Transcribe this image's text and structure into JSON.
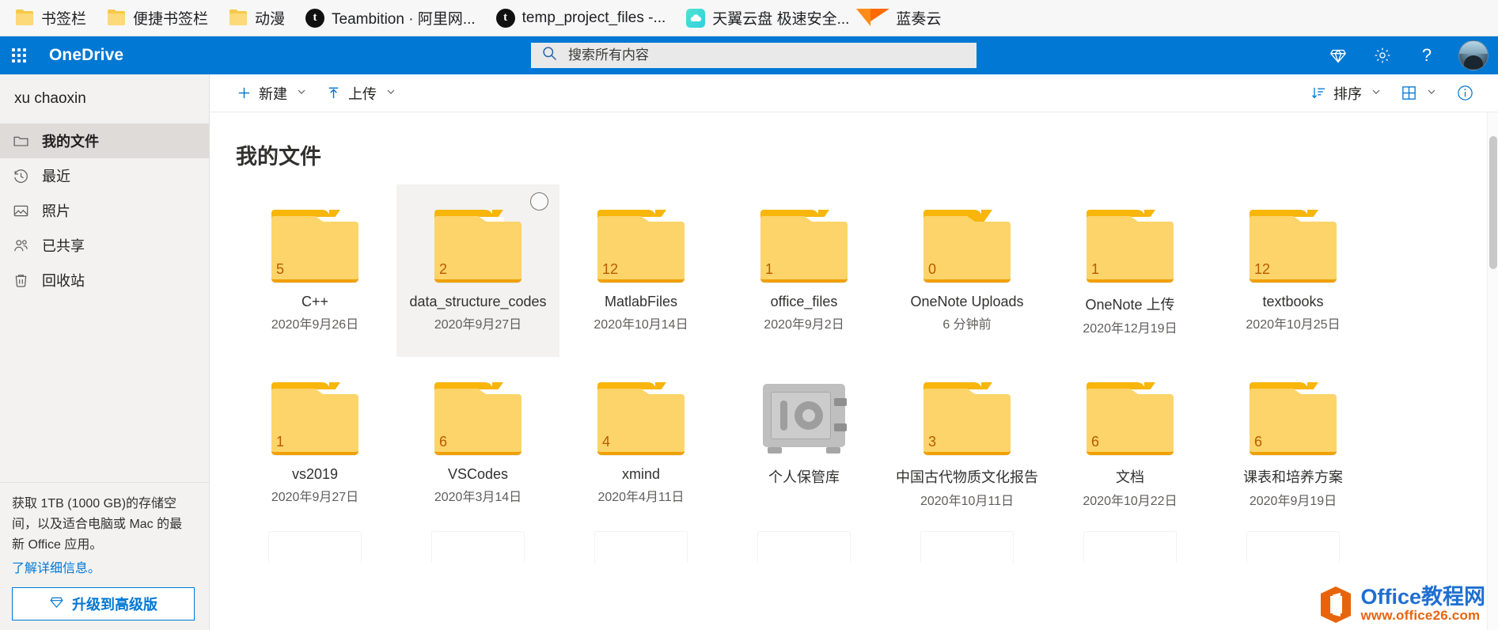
{
  "browser": {
    "bookmarks": [
      {
        "label": "书签栏",
        "icon": "folder-icon"
      },
      {
        "label": "便捷书签栏",
        "icon": "folder-icon"
      },
      {
        "label": "动漫",
        "icon": "folder-icon"
      },
      {
        "label": "Teambition · 阿里网...",
        "icon": "teambition-icon"
      },
      {
        "label": "temp_project_files -...",
        "icon": "teambition-icon"
      },
      {
        "label": "天翼云盘 极速安全...",
        "icon": "cloud-icon"
      },
      {
        "label": "蓝奏云",
        "icon": "lanzou-icon"
      }
    ]
  },
  "header": {
    "brand": "OneDrive",
    "waffle_label": "app-launcher",
    "search": {
      "placeholder": "搜索所有内容",
      "value": "",
      "icon": "search-icon"
    },
    "actions": [
      {
        "name": "premium-diamond-icon",
        "label": "高级版"
      },
      {
        "name": "gear-icon",
        "label": "设置"
      },
      {
        "name": "help-icon",
        "label": "帮助"
      }
    ],
    "avatar_label": "账户管理器",
    "accent_color": "#0078d4"
  },
  "sidebar": {
    "user": "xu chaoxin",
    "items": [
      {
        "label": "我的文件",
        "icon": "folder-icon",
        "selected": true
      },
      {
        "label": "最近",
        "icon": "clock-icon",
        "selected": false
      },
      {
        "label": "照片",
        "icon": "photo-icon",
        "selected": false
      },
      {
        "label": "已共享",
        "icon": "people-icon",
        "selected": false
      },
      {
        "label": "回收站",
        "icon": "recycle-bin-icon",
        "selected": false
      }
    ],
    "promo": {
      "text": "获取 1TB (1000 GB)的存储空间，以及适合电脑或 Mac 的最新 Office 应用。",
      "link": "了解详细信息。",
      "button": "升级到高级版",
      "button_icon": "diamond-icon"
    }
  },
  "commandbar": {
    "left": [
      {
        "label": "新建",
        "icon": "plus-icon",
        "has_chevron": true
      },
      {
        "label": "上传",
        "icon": "upload-arrow-icon",
        "has_chevron": true
      }
    ],
    "right": [
      {
        "label": "排序",
        "icon": "sort-icon",
        "has_chevron": true
      },
      {
        "label": "",
        "icon": "tiles-view-icon",
        "has_chevron": true
      },
      {
        "label": "",
        "icon": "info-icon",
        "has_chevron": false
      }
    ]
  },
  "main": {
    "title": "我的文件",
    "tiles": [
      {
        "name": "C++",
        "date": "2020年9月26日",
        "count": "5",
        "kind": "folder",
        "selected": false,
        "syncing": false
      },
      {
        "name": "data_structure_codes",
        "date": "2020年9月27日",
        "count": "2",
        "kind": "folder",
        "selected": true,
        "syncing": false
      },
      {
        "name": "MatlabFiles",
        "date": "2020年10月14日",
        "count": "12",
        "kind": "folder",
        "selected": false,
        "syncing": false
      },
      {
        "name": "office_files",
        "date": "2020年9月2日",
        "count": "1",
        "kind": "folder",
        "selected": false,
        "syncing": false
      },
      {
        "name": "OneNote Uploads",
        "date": "6 分钟前",
        "count": "0",
        "kind": "folder-empty",
        "selected": false,
        "syncing": true
      },
      {
        "name": "OneNote 上传",
        "date": "2020年12月19日",
        "count": "1",
        "kind": "folder",
        "selected": false,
        "syncing": false
      },
      {
        "name": "textbooks",
        "date": "2020年10月25日",
        "count": "12",
        "kind": "folder",
        "selected": false,
        "syncing": false
      },
      {
        "name": "vs2019",
        "date": "2020年9月27日",
        "count": "1",
        "kind": "folder",
        "selected": false,
        "syncing": false
      },
      {
        "name": "VSCodes",
        "date": "2020年3月14日",
        "count": "6",
        "kind": "folder",
        "selected": false,
        "syncing": false
      },
      {
        "name": "xmind",
        "date": "2020年4月11日",
        "count": "4",
        "kind": "folder-thumb-xmind",
        "selected": false,
        "syncing": false
      },
      {
        "name": "个人保管库",
        "date": "",
        "count": "",
        "kind": "vault",
        "selected": false,
        "syncing": false
      },
      {
        "name": "中国古代物质文化报告",
        "date": "2020年10月11日",
        "count": "3",
        "kind": "folder-thumb-note",
        "selected": false,
        "syncing": false
      },
      {
        "name": "文档",
        "date": "2020年10月22日",
        "count": "6",
        "kind": "folder",
        "selected": false,
        "syncing": false
      },
      {
        "name": "课表和培养方案",
        "date": "2020年9月19日",
        "count": "6",
        "kind": "folder",
        "selected": false,
        "syncing": false
      }
    ]
  },
  "watermark": {
    "title": "Office教程网",
    "subtitle": "www.office26.com"
  }
}
